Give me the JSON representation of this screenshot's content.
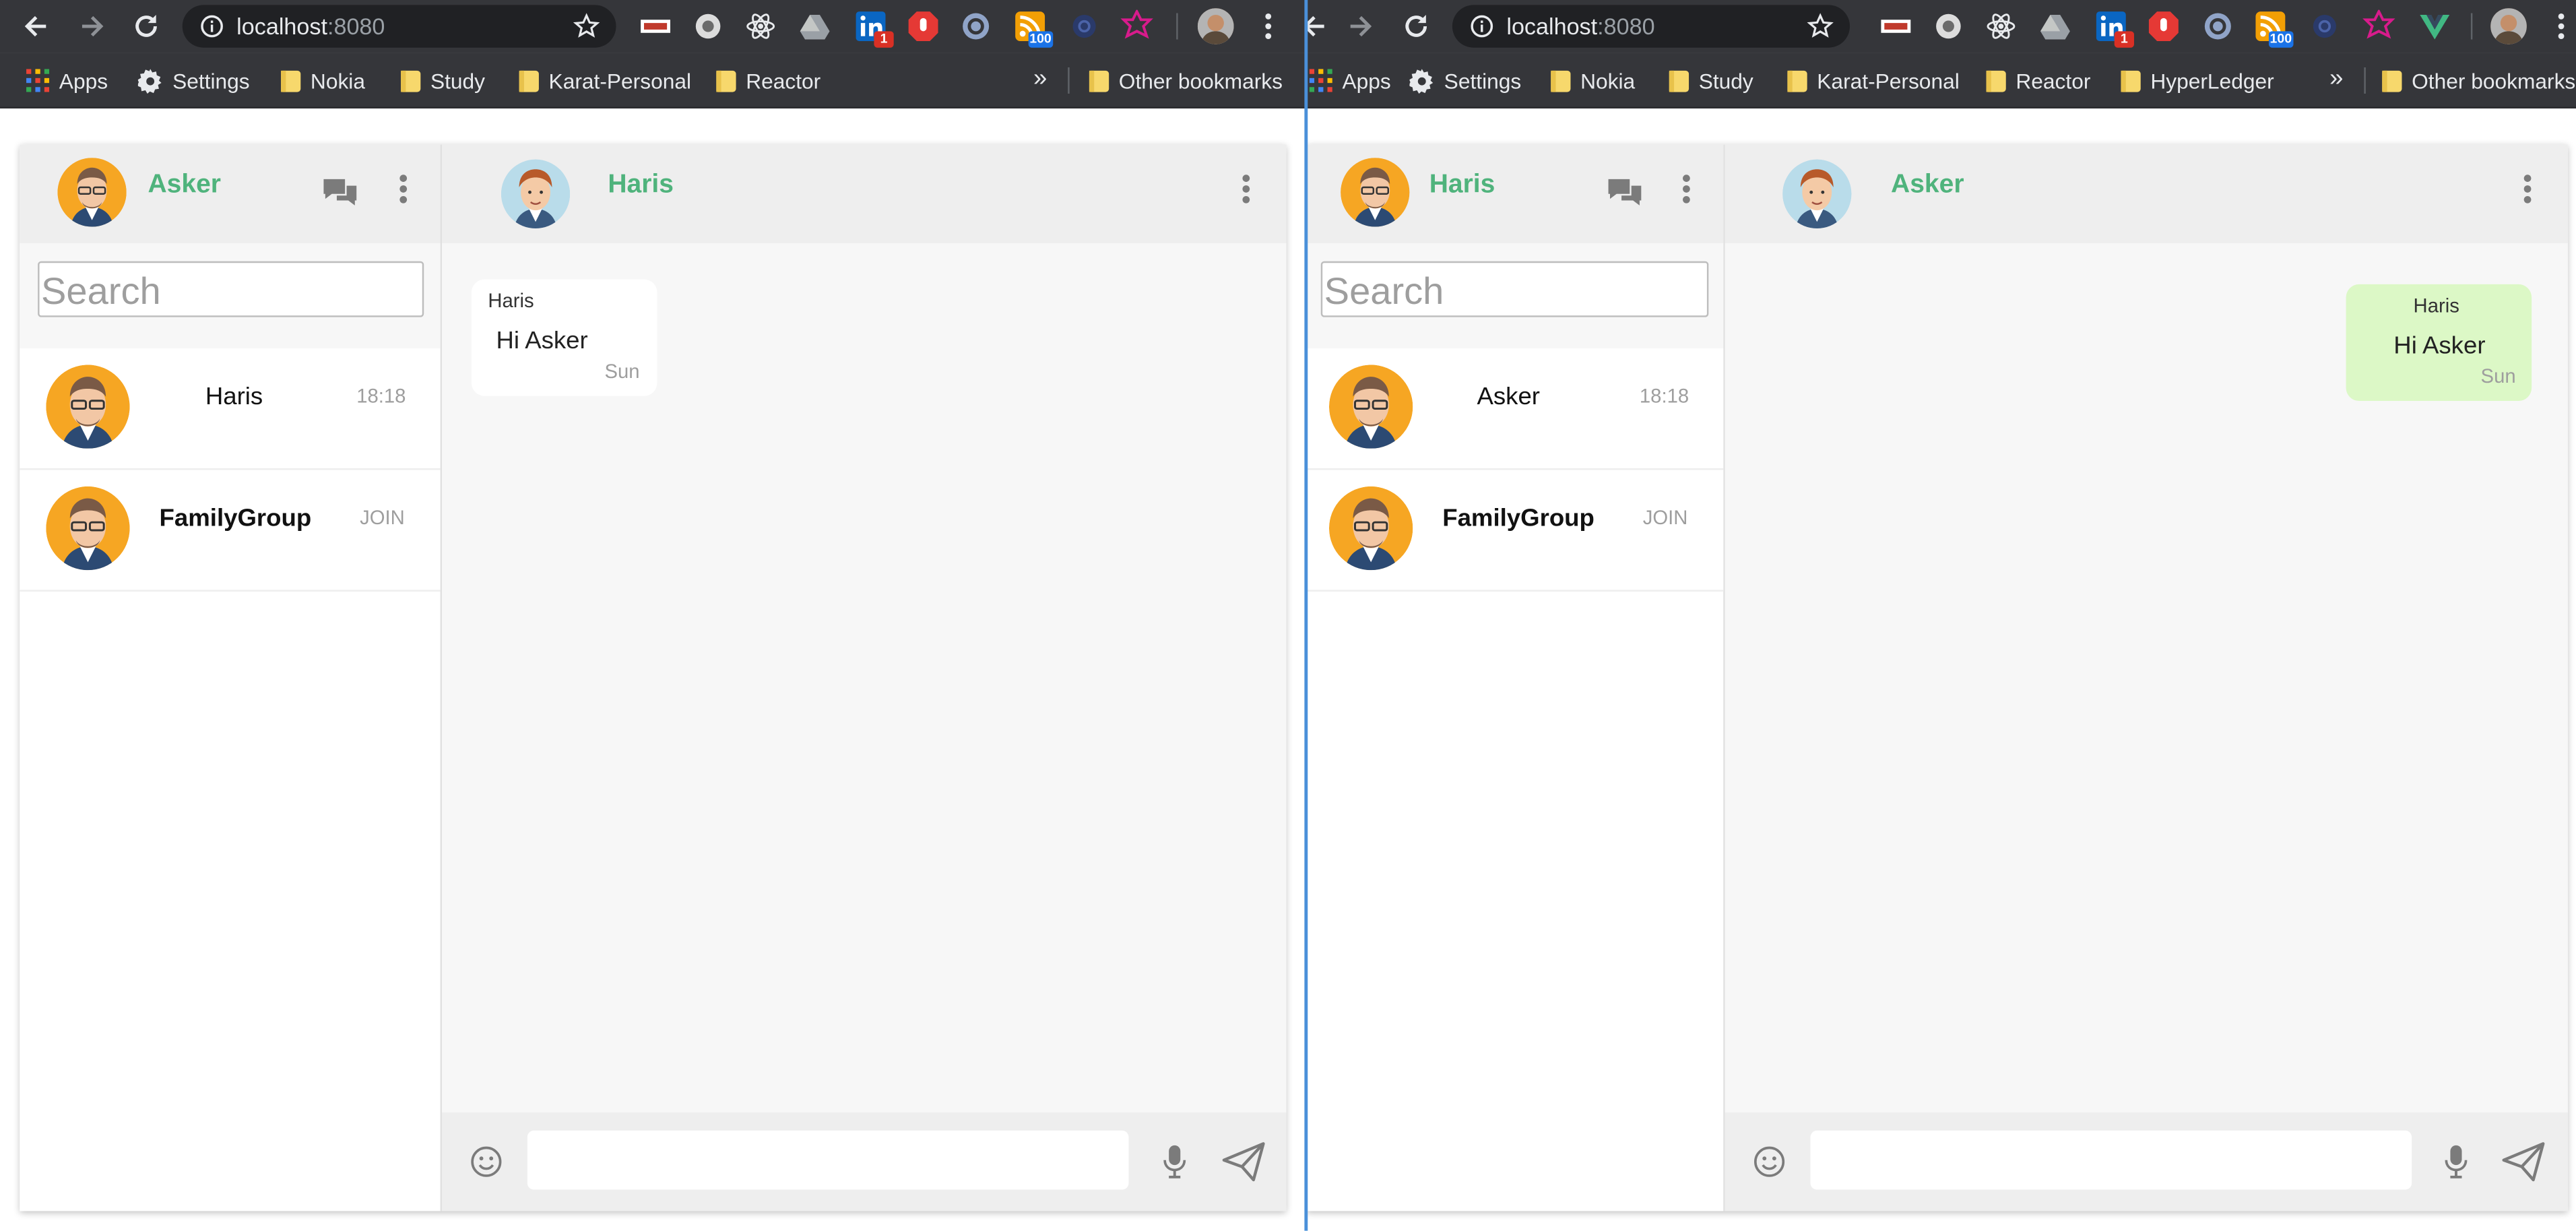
{
  "left": {
    "toolbar": {
      "url_host": "localhost",
      "url_port": ":8080"
    },
    "extensions": [
      {
        "icon": "ublock-icon"
      },
      {
        "icon": "circle-extension-icon"
      },
      {
        "icon": "react-devtools-icon"
      },
      {
        "icon": "drive-icon"
      },
      {
        "icon": "linkedin-icon",
        "badge": "1"
      },
      {
        "icon": "stop-hand-icon"
      },
      {
        "icon": "search-extension-icon"
      },
      {
        "icon": "rss-icon",
        "badge": "100"
      },
      {
        "icon": "dark-extension-icon"
      },
      {
        "icon": "redux-star-icon"
      }
    ],
    "bookmarks": {
      "apps": "Apps",
      "items": [
        "Settings",
        "Nokia",
        "Study",
        "Karat-Personal",
        "Reactor"
      ],
      "overflow": "»",
      "other": "Other bookmarks"
    },
    "chat": {
      "me": "Asker",
      "active": "Haris",
      "search_placeholder": "Search",
      "contacts": [
        {
          "name": "Haris",
          "meta": "18:18"
        },
        {
          "name": "FamilyGroup",
          "meta": "JOIN"
        }
      ],
      "messages": [
        {
          "sender": "Haris",
          "text": "Hi Asker",
          "time": "Sun"
        }
      ]
    }
  },
  "right": {
    "toolbar": {
      "url_host": "localhost",
      "url_port": ":8080"
    },
    "extensions": [
      {
        "icon": "ublock-icon"
      },
      {
        "icon": "circle-extension-icon"
      },
      {
        "icon": "react-devtools-icon"
      },
      {
        "icon": "drive-icon"
      },
      {
        "icon": "linkedin-icon",
        "badge": "1"
      },
      {
        "icon": "stop-hand-icon"
      },
      {
        "icon": "search-extension-icon"
      },
      {
        "icon": "rss-icon",
        "badge": "100"
      },
      {
        "icon": "dark-extension-icon"
      },
      {
        "icon": "redux-star-icon"
      },
      {
        "icon": "vue-devtools-icon"
      }
    ],
    "bookmarks": {
      "apps": "Apps",
      "items": [
        "Settings",
        "Nokia",
        "Study",
        "Karat-Personal",
        "Reactor",
        "HyperLedger"
      ],
      "overflow": "»",
      "other": "Other bookmarks"
    },
    "chat": {
      "me": "Haris",
      "active": "Asker",
      "search_placeholder": "Search",
      "contacts": [
        {
          "name": "Asker",
          "meta": "18:18"
        },
        {
          "name": "FamilyGroup",
          "meta": "JOIN"
        }
      ],
      "messages": [
        {
          "sender": "Haris",
          "text": "Hi Asker",
          "time": "Sun"
        }
      ]
    }
  },
  "colors": {
    "chrome_dark": "#35363a",
    "accent_green": "#4fb37c",
    "outgoing_bubble": "#dcf8c6",
    "incoming_bubble": "#ffffff"
  }
}
